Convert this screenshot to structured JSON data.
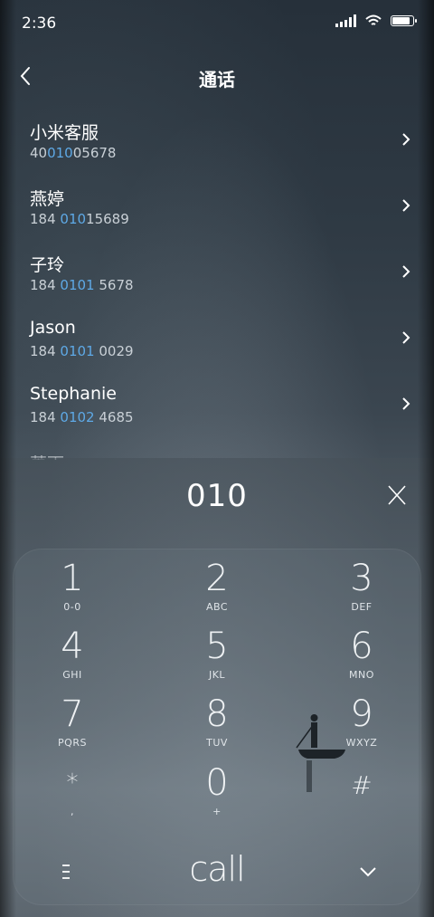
{
  "status_bar": {
    "time": "2:36"
  },
  "header": {
    "title": "通话"
  },
  "contacts": [
    {
      "name": "小米客服",
      "number_pre": "40",
      "number_hl": "010",
      "number_post": "05678"
    },
    {
      "name": "燕婷",
      "number_pre": "184 ",
      "number_hl": "010",
      "number_post": "15689"
    },
    {
      "name": "子玲",
      "number_pre": "184 ",
      "number_hl": "0101",
      "number_post": " 5678"
    },
    {
      "name": "Jason",
      "number_pre": "184 ",
      "number_hl": "0101",
      "number_post": " 0029"
    },
    {
      "name": "Stephanie",
      "number_pre": "184 ",
      "number_hl": "0102",
      "number_post": " 4685"
    }
  ],
  "partial_contact": {
    "name": "萧雨"
  },
  "dialer": {
    "input": "010",
    "keys": [
      {
        "digit": "1",
        "letters": "0-0"
      },
      {
        "digit": "2",
        "letters": "ABC"
      },
      {
        "digit": "3",
        "letters": "DEF"
      },
      {
        "digit": "4",
        "letters": "GHI"
      },
      {
        "digit": "5",
        "letters": "JKL"
      },
      {
        "digit": "6",
        "letters": "MNO"
      },
      {
        "digit": "7",
        "letters": "PQRS"
      },
      {
        "digit": "8",
        "letters": "TUV"
      },
      {
        "digit": "9",
        "letters": "WXYZ"
      },
      {
        "digit": "*",
        "letters": ","
      },
      {
        "digit": "0",
        "letters": "+"
      },
      {
        "digit": "#",
        "letters": ""
      }
    ],
    "call_label": "call"
  },
  "colors": {
    "highlight": "#5ea9e6",
    "text": "#ffffff",
    "subtext": "#c9d0d6"
  },
  "icons": {
    "back": "chevron-left-icon",
    "row_chevron": "chevron-right-icon",
    "clear": "close-icon",
    "menu": "menu-icon",
    "hide": "chevron-down-icon"
  }
}
